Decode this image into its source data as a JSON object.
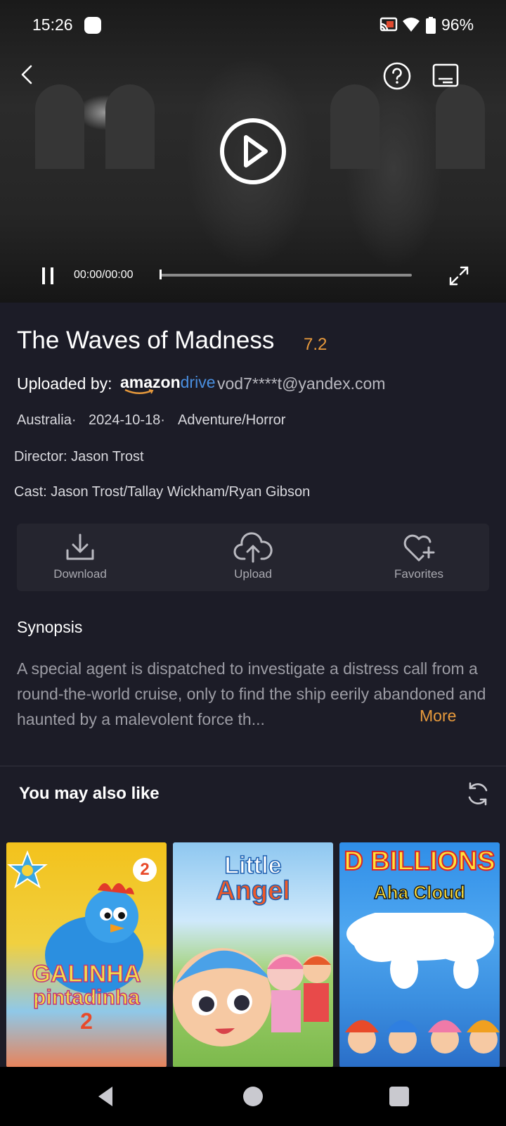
{
  "status_bar": {
    "time": "15:26",
    "battery": "96%"
  },
  "player": {
    "time": "00:00/00:00",
    "progress": 0.0
  },
  "movie": {
    "title": "The Waves of Madness",
    "rating": "7.2",
    "uploaded_label": "Uploaded by:",
    "brand_a": "amazon",
    "brand_b": "drive",
    "uploader": "vod7****t@yandex.com",
    "country": "Australia·",
    "date": "2024-10-18·",
    "genre": "Adventure/Horror",
    "director": "Director: Jason Trost",
    "cast": "Cast: Jason Trost/Tallay Wickham/Ryan Gibson"
  },
  "actions": {
    "download": "Download",
    "upload": "Upload",
    "favorites": "Favorites"
  },
  "synopsis": {
    "heading": "Synopsis",
    "text": "A special agent is dispatched to investigate a distress call from a round-the-world cruise, only to find the ship eerily abandoned and haunted by a malevolent force th...",
    "more": "More"
  },
  "recommendations": {
    "heading": "You may also like",
    "items": [
      {
        "line1": "GALINHA",
        "line2": "pintadinha",
        "line3": "2",
        "badge": "2"
      },
      {
        "line1": "Little",
        "line2": "Angel"
      },
      {
        "line1": "D BILLIONS",
        "line2": "Aha Cloud"
      }
    ]
  },
  "icons": {
    "back": "back-arrow-icon",
    "help": "help-icon",
    "subtitles": "subtitles-icon",
    "play": "play-icon",
    "pause": "pause-icon",
    "fullscreen": "fullscreen-icon",
    "download": "download-icon",
    "upload": "upload-cloud-icon",
    "favorites": "heart-plus-icon",
    "refresh": "refresh-icon"
  },
  "colors": {
    "accent": "#e89a3c",
    "background": "#1c1c27",
    "brand_blue": "#4a8fe0"
  }
}
